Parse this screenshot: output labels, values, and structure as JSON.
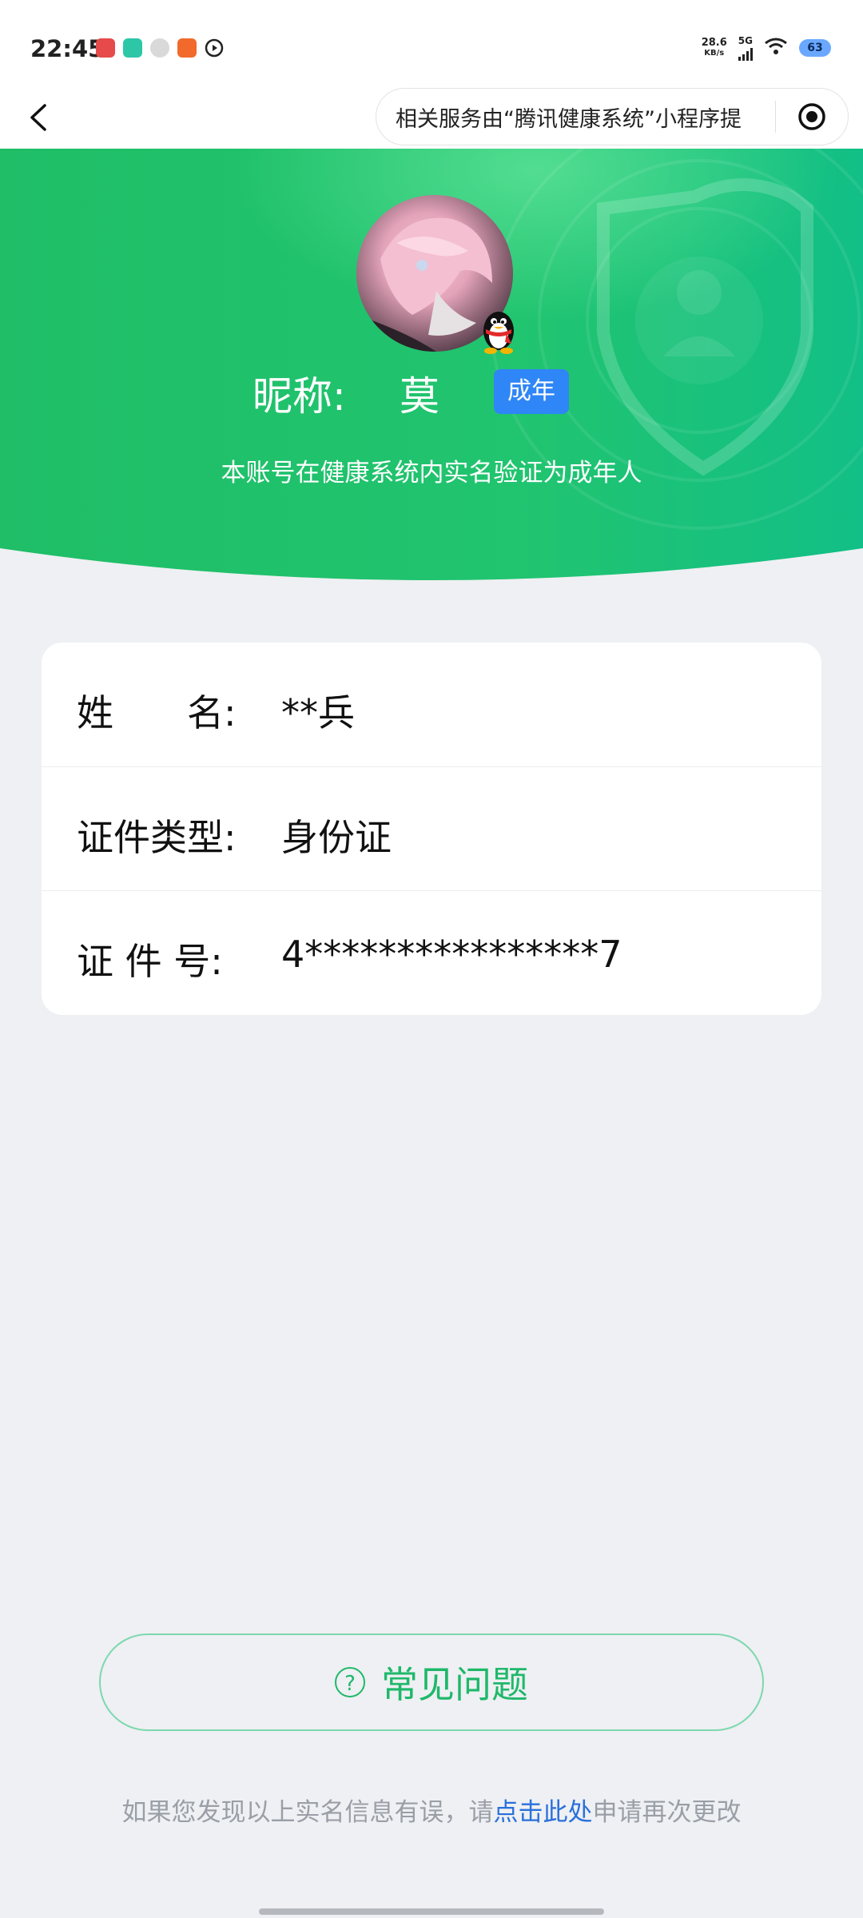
{
  "status_bar": {
    "time": "22:45",
    "net_speed_value": "28.6",
    "net_speed_unit": "KB/s",
    "network": "5G",
    "battery": "63"
  },
  "nav": {
    "capsule_text": "相关服务由“腾讯健康系统”小程序提",
    "back_icon": "chevron-left-icon",
    "record_icon": "target-icon"
  },
  "hero": {
    "nick_label": "昵称:",
    "nick_value": "莫",
    "badge": "成年",
    "description": "本账号在健康系统内实名验证为成年人",
    "colors": {
      "green_start": "#22c06a",
      "green_end": "#0fbf84"
    }
  },
  "info": {
    "rows": [
      {
        "label": "姓　　名:",
        "value": "**兵"
      },
      {
        "label": "证件类型:",
        "value": "身份证"
      },
      {
        "label": "证 件 号:",
        "value": "4****************7"
      }
    ]
  },
  "faq": {
    "icon": "question-circle-icon",
    "label": "常见问题"
  },
  "footer": {
    "prefix": "如果您发现以上实名信息有误，请",
    "link": "点击此处",
    "suffix": "申请再次更改"
  }
}
